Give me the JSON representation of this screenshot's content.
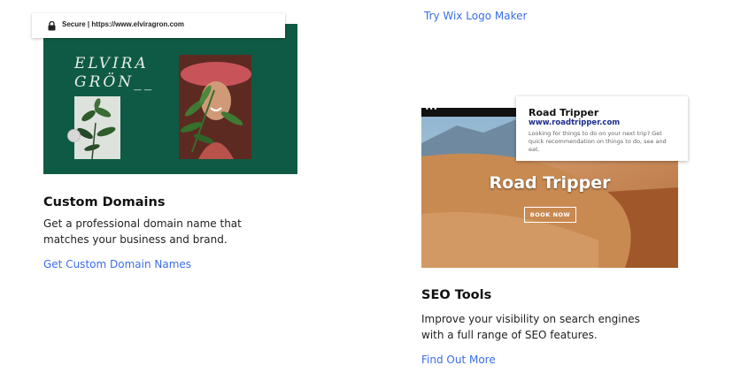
{
  "top_link": {
    "label": "Try Wix Logo Maker"
  },
  "domains": {
    "browser_bar": {
      "secure_label": "Secure",
      "url": "https://www.elviragron.com"
    },
    "preview_brand_line1": "ELVIRA",
    "preview_brand_line2": "GRÖN__",
    "heading": "Custom Domains",
    "description_line1": "Get a professional domain name that",
    "description_line2": "matches your business and brand.",
    "link": "Get Custom Domain Names"
  },
  "seo": {
    "preview": {
      "site_title": "Road Tripper",
      "result_title": "Road Tripper",
      "result_url": "www.roadtripper.com",
      "result_desc": "Looking for things to do on your next trip? Get quick recommendation on things to do, see and eat.",
      "button": "BOOK NOW",
      "dots": "•••"
    },
    "heading": "SEO Tools",
    "description_line1": "Improve your visibility on search engines",
    "description_line2": "with a full range of SEO features.",
    "link": "Find Out More"
  },
  "colors": {
    "link": "#3b6ee8",
    "card_green": "#0f5a44"
  }
}
